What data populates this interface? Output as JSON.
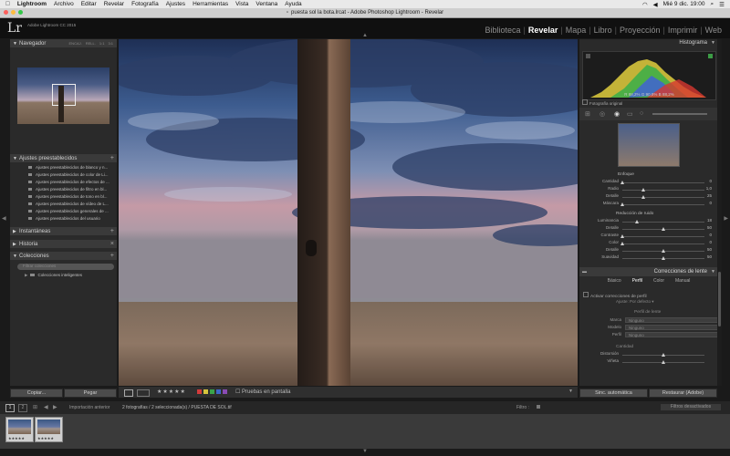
{
  "mac_menu": {
    "apple": "",
    "app": "Lightroom",
    "items": [
      "Archivo",
      "Editar",
      "Revelar",
      "Fotografía",
      "Ajustes",
      "Herramientas",
      "Vista",
      "Ventana",
      "Ayuda"
    ],
    "datetime": "Mié 9 dic. 19:00"
  },
  "window_title": "puesta sol la bota.lrcat - Adobe Photoshop Lightroom - Revelar",
  "identity": {
    "logo": "Lr",
    "version": "Adobe Lightroom CC 2015"
  },
  "modules": [
    "Biblioteca",
    "Revelar",
    "Mapa",
    "Libro",
    "Proyección",
    "Imprimir",
    "Web"
  ],
  "left": {
    "navigator": {
      "title": "Navegador",
      "zoom": [
        "ENCAJ.",
        "RELL.",
        "1:1",
        "3:1"
      ]
    },
    "presets": {
      "title": "Ajustes preestablecidos",
      "items": [
        "Ajustes preestablecidos de blanco y n...",
        "Ajustes preestablecidos de color de Li...",
        "Ajustes preestablecidos de efectos de ...",
        "Ajustes preestablecidos de filtro en bl...",
        "Ajustes preestablecidos de tono en bl...",
        "Ajustes preestablecidos de vídeo de L...",
        "Ajustes preestablecidos generales de ...",
        "Ajustes preestablecidos del usuario"
      ]
    },
    "snapshots": {
      "title": "Instantáneas"
    },
    "history": {
      "title": "Historia"
    },
    "collections": {
      "title": "Colecciones",
      "search_placeholder": "Filtrar colecciones",
      "smart": "Colecciones inteligentes"
    },
    "copy_label": "Copiar...",
    "paste_label": "Pegar"
  },
  "right": {
    "histogram": {
      "title": "Histograma",
      "r_label": "R",
      "r": "88,2",
      "g_label": "G",
      "g": "90,8",
      "b_label": "B",
      "b": "88,2",
      "unit": "%"
    },
    "original_photo": "Fotografía original",
    "detail": {
      "sharpen_title": "Enfoque",
      "sharpen": [
        {
          "label": "Cantidad",
          "value": "0",
          "pos": 0
        },
        {
          "label": "Radio",
          "value": "1,0",
          "pos": 0.25
        },
        {
          "label": "Detalle",
          "value": "25",
          "pos": 0.25
        },
        {
          "label": "Máscara",
          "value": "0",
          "pos": 0
        }
      ],
      "noise_title": "Reducción de ruido",
      "noise": [
        {
          "label": "Luminancia",
          "value": "18",
          "pos": 0.18
        },
        {
          "label": "Detalle",
          "value": "50",
          "pos": 0.5
        },
        {
          "label": "Contraste",
          "value": "0",
          "pos": 0
        },
        {
          "label": "Color",
          "value": "0",
          "pos": 0
        },
        {
          "label": "Detalle",
          "value": "50",
          "pos": 0.5
        },
        {
          "label": "Suavidad",
          "value": "50",
          "pos": 0.5
        }
      ]
    },
    "lens": {
      "title": "Correcciones de lente",
      "tabs": [
        "Básico",
        "Perfil",
        "Color",
        "Manual"
      ],
      "active_tab": "Perfil",
      "enable": "Activar correcciones de perfil",
      "setup_label": "Ajuste",
      "setup_value": "Por defecto",
      "profile_title": "Perfil de lente",
      "fields": [
        {
          "label": "Marca",
          "value": "Ninguno"
        },
        {
          "label": "Modelo",
          "value": "Ninguno"
        },
        {
          "label": "Perfil",
          "value": "Ninguno"
        }
      ],
      "amount_title": "Cantidad",
      "amount": [
        {
          "label": "Distorsión",
          "value": "",
          "pos": 0.5
        },
        {
          "label": "Viñeta",
          "value": "",
          "pos": 0.5
        }
      ]
    },
    "sync_label": "Sinc. automática",
    "reset_label": "Restaurar (Adobe)"
  },
  "toolbar": {
    "stars": "★★★★★",
    "proof_label": "Pruebas en pantalla"
  },
  "filmstrip": {
    "pages": [
      "1",
      "2"
    ],
    "prev_import": "Importación anterior",
    "selection": "2 fotografías / 2 seleccionada(s) / PUESTA DE SOL.tif",
    "filter_label": "Filtro :",
    "filter_value": "Filtros desactivados"
  },
  "colors": {
    "accent": "#ffffff",
    "panel": "#2a2a2a",
    "header": "#3a3a3a"
  }
}
